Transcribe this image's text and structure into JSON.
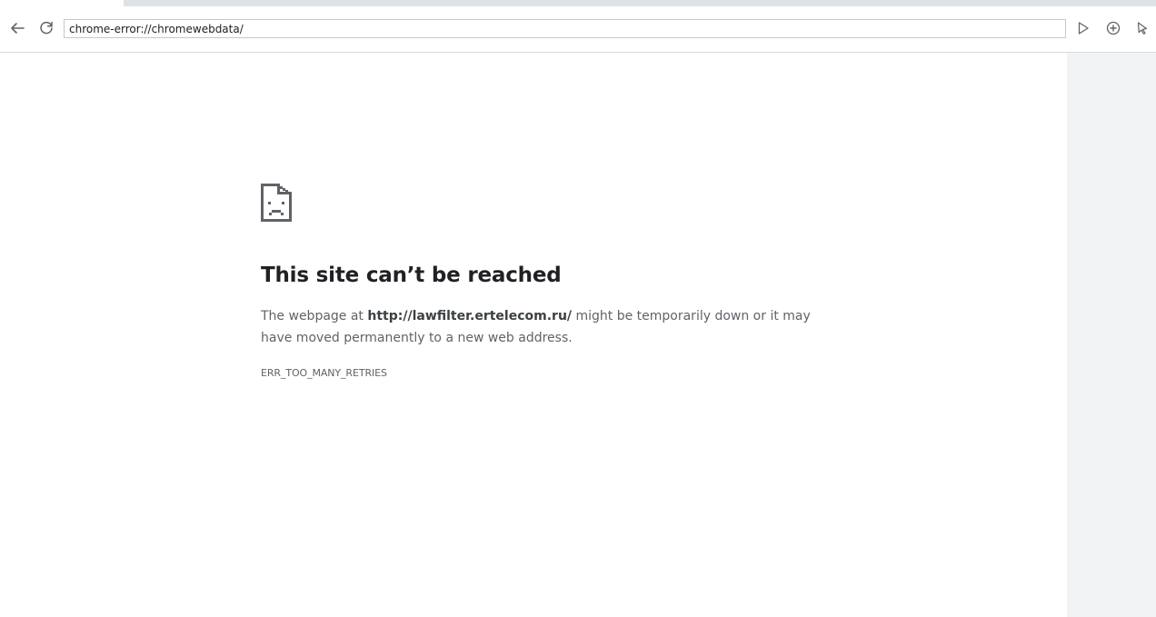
{
  "browser": {
    "address_bar": {
      "value": "chrome-error://chromewebdata/"
    },
    "icons": {
      "back": "arrow-left-icon",
      "reload": "reload-icon",
      "play": "play-icon",
      "add": "add-circle-icon",
      "cursor": "cursor-icon"
    }
  },
  "error_page": {
    "icon": "sad-page-icon",
    "title": "This site can’t be reached",
    "message_prefix": "The webpage at ",
    "url": "http://lawfilter.ertelecom.ru/",
    "message_suffix": " might be temporarily down or it may have moved permanently to a new web address.",
    "error_code": "ERR_TOO_MANY_RETRIES"
  },
  "colors": {
    "title_text": "#202124",
    "body_text": "#5f6368",
    "side_panel": "#f1f3f4",
    "tab_strip": "#dee1e6"
  }
}
